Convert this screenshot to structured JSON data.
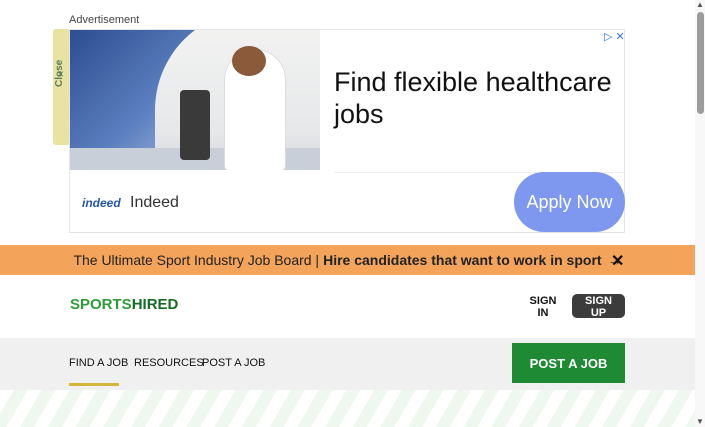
{
  "ad": {
    "label": "Advertisement",
    "close_label": "Close",
    "close_icon": "×",
    "headline": "Find flexible healthcare jobs",
    "logo_text": "indeed",
    "brand": "Indeed",
    "cta": "Apply Now",
    "adchoices_icons": "▷ ✕"
  },
  "banner": {
    "text": "The Ultimate Sport Industry Job Board |",
    "bold_text": "Hire candidates that want to work in sport",
    "arrow": "→",
    "close": "✕"
  },
  "header": {
    "logo_sports": "SPORTS",
    "logo_hired": "HIRED",
    "sign_in": "SIGN IN",
    "sign_up": "SIGN UP"
  },
  "nav": {
    "items": [
      "FIND A JOB",
      "RESOURCES",
      "POST A JOB"
    ],
    "cta": "POST A JOB"
  },
  "colors": {
    "banner": "#f4a45a",
    "brand_green": "#2d9d3a",
    "cta_blue": "#7e98ef",
    "active_underline": "#d4b63a"
  }
}
